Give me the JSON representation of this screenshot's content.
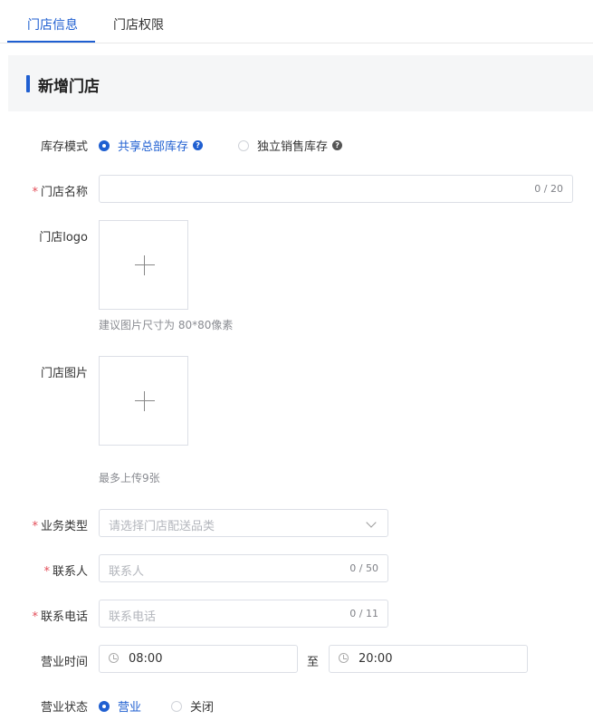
{
  "tabs": [
    {
      "label": "门店信息"
    },
    {
      "label": "门店权限"
    }
  ],
  "section": {
    "title": "新增门店"
  },
  "stock_mode": {
    "label": "库存模式",
    "options": [
      {
        "label": "共享总部库存",
        "selected": true
      },
      {
        "label": "独立销售库存",
        "selected": false
      }
    ]
  },
  "store_name": {
    "label": "门店名称",
    "required": "*",
    "value": "",
    "counter": "0 / 20"
  },
  "store_logo": {
    "label": "门店logo",
    "hint": "建议图片尺寸为 80*80像素"
  },
  "store_images": {
    "label": "门店图片",
    "hint": "最多上传9张"
  },
  "business_type": {
    "label": "业务类型",
    "required": "*",
    "placeholder": "请选择门店配送品类"
  },
  "contact": {
    "label": "联系人",
    "required": "*",
    "placeholder": "联系人",
    "counter": "0 / 50"
  },
  "phone": {
    "label": "联系电话",
    "required": "*",
    "placeholder": "联系电话",
    "counter": "0 / 11"
  },
  "hours": {
    "label": "营业时间",
    "start": "08:00",
    "separator": "至",
    "end": "20:00"
  },
  "status": {
    "label": "营业状态",
    "options": [
      {
        "label": "营业",
        "selected": true
      },
      {
        "label": "关闭",
        "selected": false
      }
    ]
  },
  "colors": {
    "accent": "#1f5fd1",
    "required": "#e34d59"
  },
  "icons": {
    "help": "question-circle-icon",
    "clock": "clock-icon",
    "upload": "plus-icon",
    "dropdown": "chevron-down-icon"
  }
}
